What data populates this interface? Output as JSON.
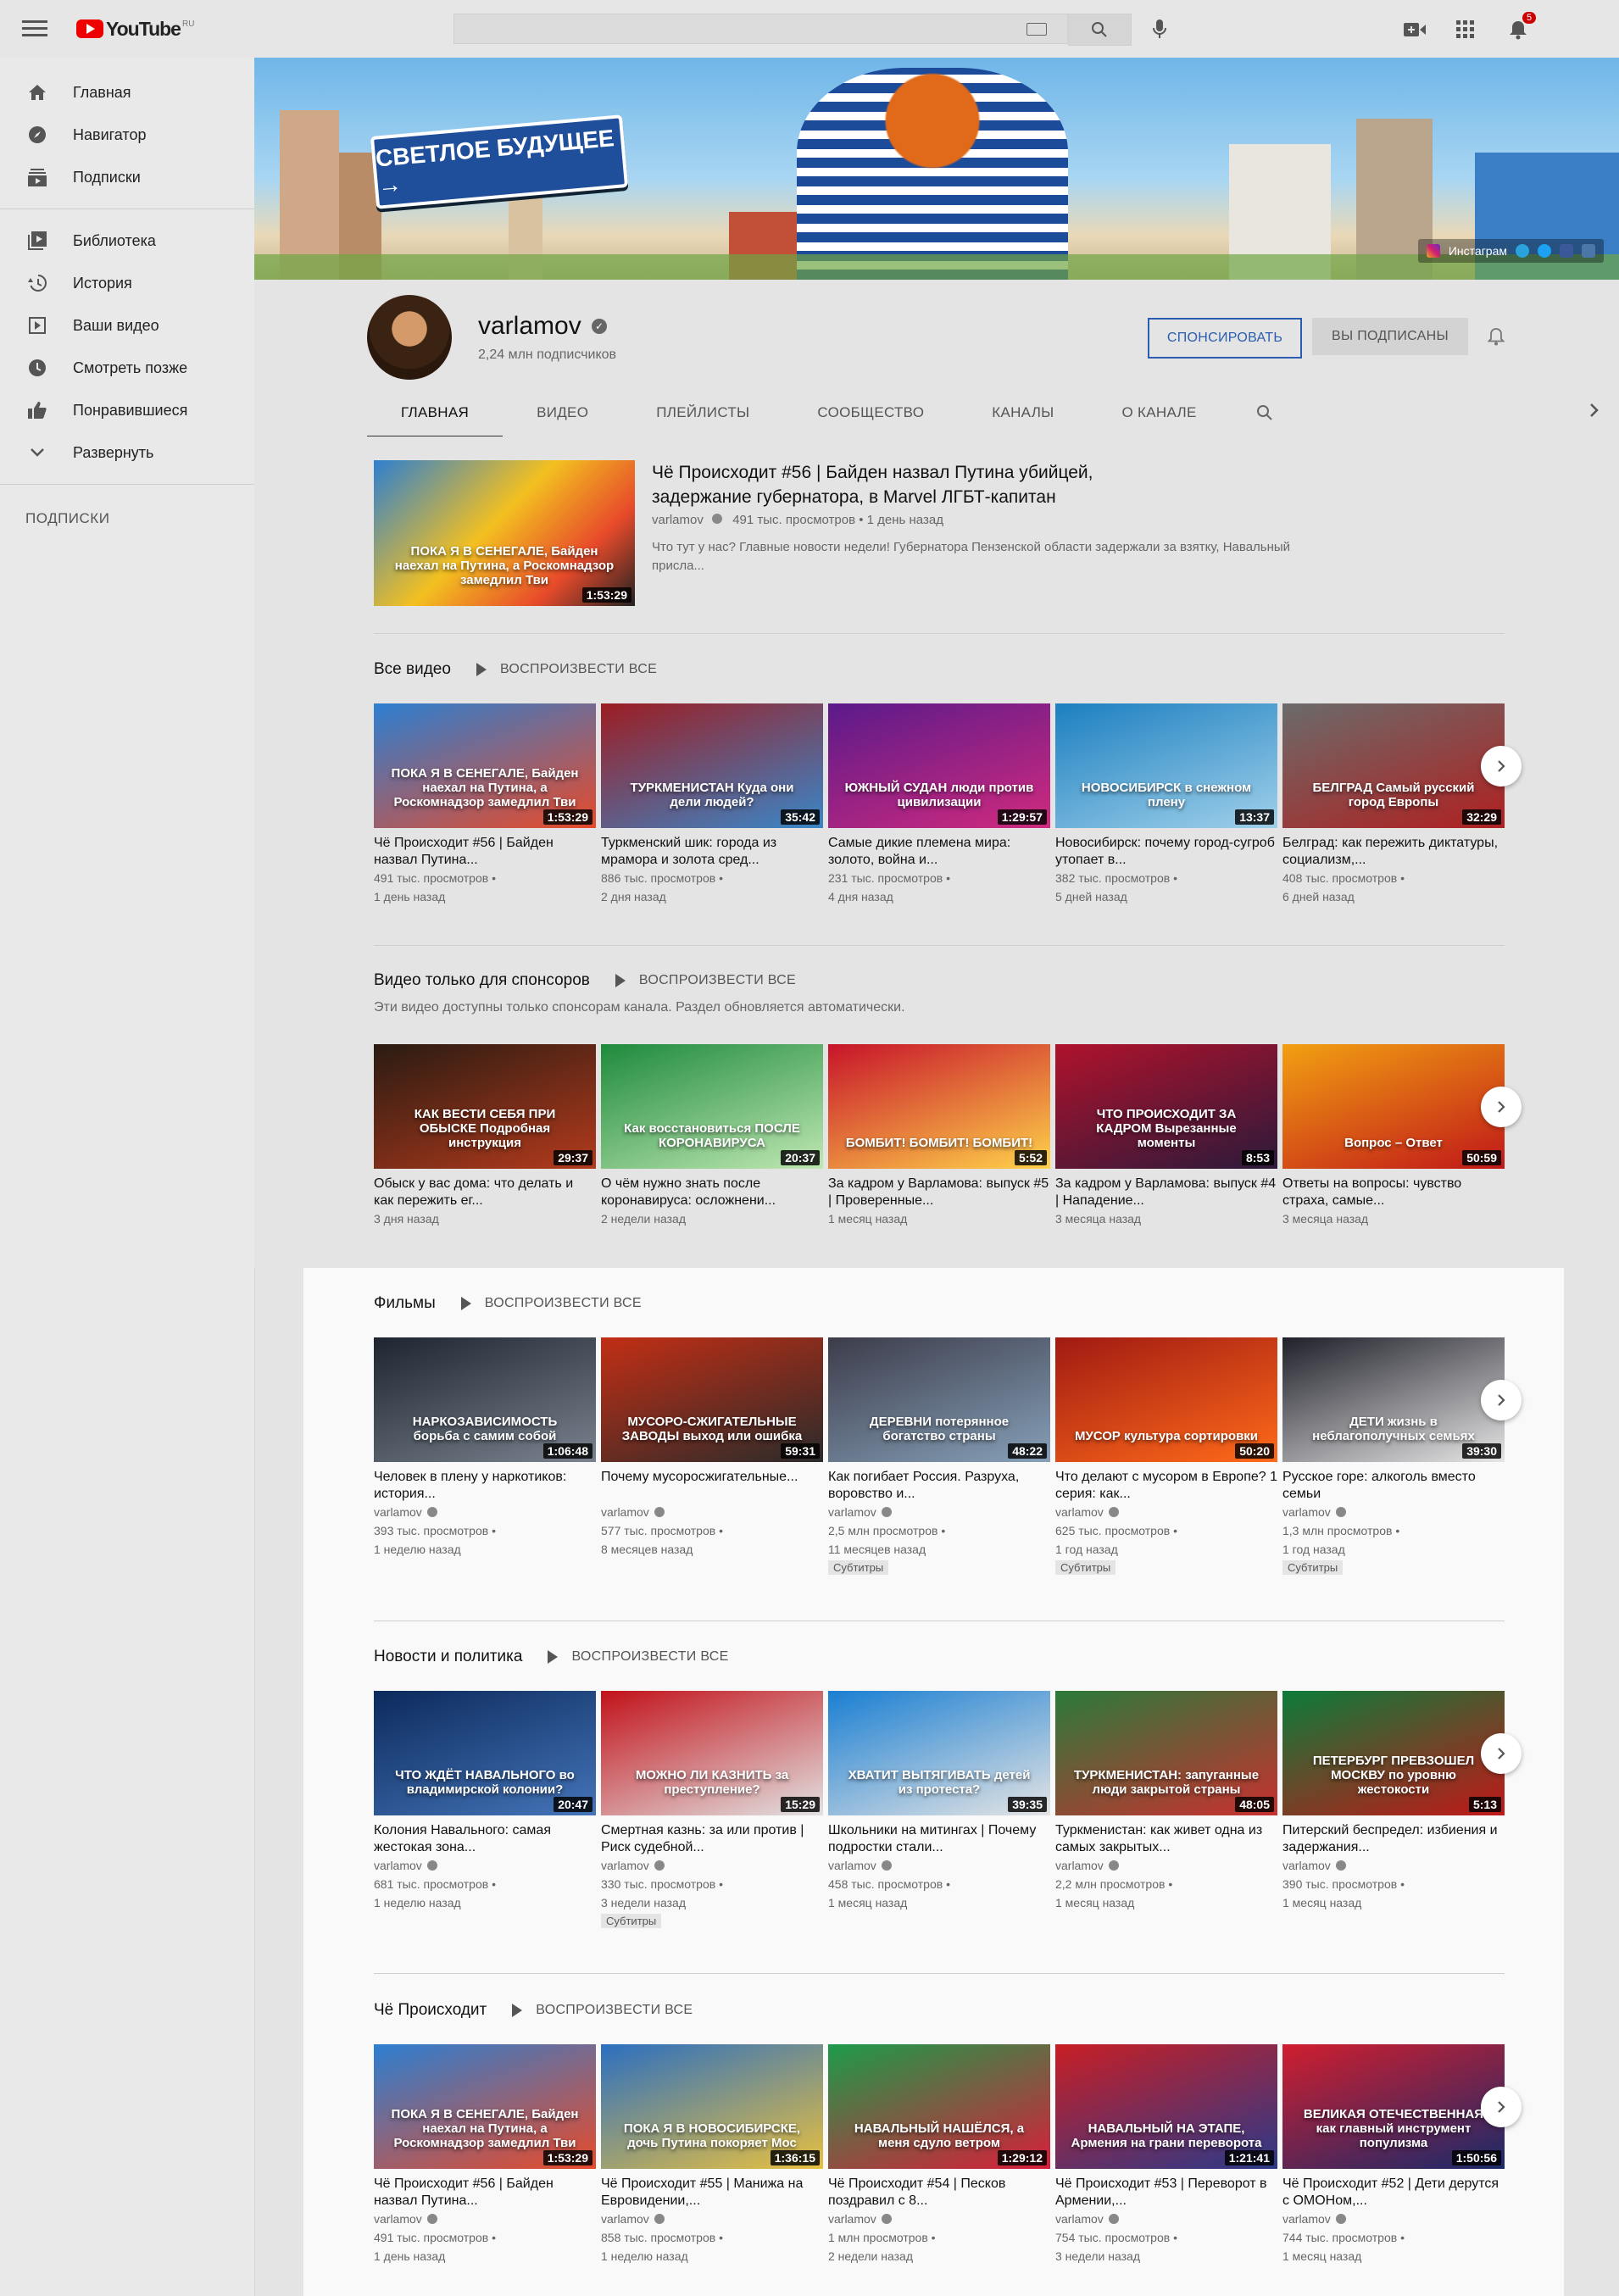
{
  "topbar": {
    "logo_text": "YouTube",
    "logo_region": "RU",
    "search_placeholder": "",
    "notifications_count": "5"
  },
  "sidebar": {
    "items": [
      {
        "label": "Главная",
        "icon": "home-icon"
      },
      {
        "label": "Навигатор",
        "icon": "compass-icon"
      },
      {
        "label": "Подписки",
        "icon": "subscriptions-icon"
      },
      {
        "label": "Библиотека",
        "icon": "library-icon"
      },
      {
        "label": "История",
        "icon": "history-icon"
      },
      {
        "label": "Ваши видео",
        "icon": "your-videos-icon"
      },
      {
        "label": "Смотреть позже",
        "icon": "clock-icon"
      },
      {
        "label": "Понравившиеся",
        "icon": "thumbs-up-icon"
      },
      {
        "label": "Развернуть",
        "icon": "chevron-down-icon"
      }
    ],
    "subscriptions_heading": "ПОДПИСКИ"
  },
  "banner": {
    "sign_text": "СВЕТЛОЕ БУДУЩЕЕ →",
    "social_label": "Инстаграм"
  },
  "channel": {
    "name": "varlamov",
    "subscribers": "2,24 млн подписчиков",
    "sponsor_label": "СПОНСИРОВАТЬ",
    "subscribed_label": "ВЫ ПОДПИСАНЫ",
    "tabs": [
      "ГЛАВНАЯ",
      "ВИДЕО",
      "ПЛЕЙЛИСТЫ",
      "СООБЩЕСТВО",
      "КАНАЛЫ",
      "О КАНАЛЕ"
    ]
  },
  "featured": {
    "title": "Чё Происходит #56 | Байден назвал Путина убийцей, задержание губернатора, в Marvel ЛГБТ-капитан",
    "channel": "varlamov",
    "views": "491 тыс. просмотров",
    "age": "1 день назад",
    "description": "Что тут у нас? Главные новости недели! Губернатора Пензенской области задержали за взятку, Навальный присла...",
    "duration": "1:53:29",
    "thumb_caption": "ПОКА Я В СЕНЕГАЛЕ, Байден наехал на Путина, а Роскомнадзор замедлил Тви"
  },
  "shelves": [
    {
      "title": "Все видео",
      "play_all": "ВОСПРОИЗВЕСТИ ВСЕ",
      "subtitle": "",
      "videos": [
        {
          "title": "Чё Происходит #56 | Байден назвал Путина...",
          "channel": "",
          "views": "491 тыс. просмотров •",
          "age": "1 день назад",
          "duration": "1:53:29",
          "caption": "ПОКА Я В СЕНЕГАЛЕ, Байден наехал на Путина, а Роскомнадзор замедлил Тви",
          "badge": ""
        },
        {
          "title": "Туркменский шик: города из мрамора и золота сред...",
          "channel": "",
          "views": "886 тыс. просмотров •",
          "age": "2 дня назад",
          "duration": "35:42",
          "caption": "ТУРКМЕНИСТАН Куда они дели людей?",
          "badge": ""
        },
        {
          "title": "Самые дикие племена мира: золото, война и...",
          "channel": "",
          "views": "231 тыс. просмотров •",
          "age": "4 дня назад",
          "duration": "1:29:57",
          "caption": "ЮЖНЫЙ СУДАН люди против цивилизации",
          "badge": ""
        },
        {
          "title": "Новосибирск: почему город-сугроб утопает в...",
          "channel": "",
          "views": "382 тыс. просмотров •",
          "age": "5 дней назад",
          "duration": "13:37",
          "caption": "НОВОСИБИРСК в снежном плену",
          "badge": ""
        },
        {
          "title": "Белград: как пережить диктатуры, социализм,...",
          "channel": "",
          "views": "408 тыс. просмотров •",
          "age": "6 дней назад",
          "duration": "32:29",
          "caption": "БЕЛГРАД Самый русский город Европы",
          "badge": ""
        }
      ]
    },
    {
      "title": "Видео только для спонсоров",
      "play_all": "ВОСПРОИЗВЕСТИ ВСЕ",
      "subtitle": "Эти видео доступны только спонсорам канала. Раздел обновляется автоматически.",
      "videos": [
        {
          "title": "Обыск у вас дома: что делать и как пережить ег...",
          "channel": "",
          "views": "",
          "age": "3 дня назад",
          "duration": "29:37",
          "caption": "КАК ВЕСТИ СЕБЯ ПРИ ОБЫСКЕ Подробная инструкция",
          "badge": ""
        },
        {
          "title": "О чём нужно знать после коронавируса: осложнени...",
          "channel": "",
          "views": "",
          "age": "2 недели назад",
          "duration": "20:37",
          "caption": "Как восстановиться ПОСЛЕ КОРОНАВИРУСА",
          "badge": ""
        },
        {
          "title": "За кадром у Варламова: выпуск #5 | Проверенные...",
          "channel": "",
          "views": "",
          "age": "1 месяц назад",
          "duration": "5:52",
          "caption": "БОМБИТ! БОМБИТ! БОМБИТ!",
          "badge": ""
        },
        {
          "title": "За кадром у Варламова: выпуск #4 | Нападение...",
          "channel": "",
          "views": "",
          "age": "3 месяца назад",
          "duration": "8:53",
          "caption": "ЧТО ПРОИСХОДИТ ЗА КАДРОМ Вырезанные моменты",
          "badge": ""
        },
        {
          "title": "Ответы на вопросы: чувство страха, самые...",
          "channel": "",
          "views": "",
          "age": "3 месяца назад",
          "duration": "50:59",
          "caption": "Вопрос – Ответ",
          "badge": ""
        }
      ]
    },
    {
      "title": "Фильмы",
      "play_all": "ВОСПРОИЗВЕСТИ ВСЕ",
      "subtitle": "",
      "videos": [
        {
          "title": "Человек в плену у наркотиков: история...",
          "channel": "varlamov",
          "views": "393 тыс. просмотров •",
          "age": "1 неделю назад",
          "duration": "1:06:48",
          "caption": "НАРКОЗАВИСИМОСТЬ борьба с самим собой",
          "badge": ""
        },
        {
          "title": "Почему мусоросжигательные...",
          "channel": "varlamov",
          "views": "577 тыс. просмотров •",
          "age": "8 месяцев назад",
          "duration": "59:31",
          "caption": "МУСОРО-СЖИГАТЕЛЬНЫЕ ЗАВОДЫ выход или ошибка",
          "badge": ""
        },
        {
          "title": "Как погибает Россия. Разруха, воровство и...",
          "channel": "varlamov",
          "views": "2,5 млн просмотров •",
          "age": "11 месяцев назад",
          "duration": "48:22",
          "caption": "ДЕРЕВНИ потерянное богатство страны",
          "badge": "Субтитры"
        },
        {
          "title": "Что делают с мусором в Европе? 1 серия: как...",
          "channel": "varlamov",
          "views": "625 тыс. просмотров •",
          "age": "1 год назад",
          "duration": "50:20",
          "caption": "МУСОР культура сортировки",
          "badge": "Субтитры"
        },
        {
          "title": "Русское горе: алкоголь вместо семьи",
          "channel": "varlamov",
          "views": "1,3 млн просмотров •",
          "age": "1 год назад",
          "duration": "39:30",
          "caption": "ДЕТИ жизнь в неблагополучных семьях",
          "badge": "Субтитры"
        }
      ]
    },
    {
      "title": "Новости и политика",
      "play_all": "ВОСПРОИЗВЕСТИ ВСЕ",
      "subtitle": "",
      "videos": [
        {
          "title": "Колония Навального: самая жестокая зона...",
          "channel": "varlamov",
          "views": "681 тыс. просмотров •",
          "age": "1 неделю назад",
          "duration": "20:47",
          "caption": "ЧТО ЖДЁТ НАВАЛЬНОГО во владимирской колонии?",
          "badge": ""
        },
        {
          "title": "Смертная казнь: за или против | Риск судебной...",
          "channel": "varlamov",
          "views": "330 тыс. просмотров •",
          "age": "3 недели назад",
          "duration": "15:29",
          "caption": "МОЖНО ЛИ КАЗНИТЬ за преступление?",
          "badge": "Субтитры"
        },
        {
          "title": "Школьники на митингах | Почему подростки стали...",
          "channel": "varlamov",
          "views": "458 тыс. просмотров •",
          "age": "1 месяц назад",
          "duration": "39:35",
          "caption": "ХВАТИТ ВЫТЯГИВАТЬ детей из протеста?",
          "badge": ""
        },
        {
          "title": "Туркменистан: как живет одна из самых закрытых...",
          "channel": "varlamov",
          "views": "2,2 млн просмотров •",
          "age": "1 месяц назад",
          "duration": "48:05",
          "caption": "ТУРКМЕНИСТАН: запуганные люди закрытой страны",
          "badge": ""
        },
        {
          "title": "Питерский беспредел: избиения и задержания...",
          "channel": "varlamov",
          "views": "390 тыс. просмотров •",
          "age": "1 месяц назад",
          "duration": "5:13",
          "caption": "ПЕТЕРБУРГ ПРЕВЗОШЕЛ МОСКВУ по уровню жестокости",
          "badge": ""
        }
      ]
    },
    {
      "title": "Чё Происходит",
      "play_all": "ВОСПРОИЗВЕСТИ ВСЕ",
      "subtitle": "",
      "videos": [
        {
          "title": "Чё Происходит #56 | Байден назвал Путина...",
          "channel": "varlamov",
          "views": "491 тыс. просмотров •",
          "age": "1 день назад",
          "duration": "1:53:29",
          "caption": "ПОКА Я В СЕНЕГАЛЕ, Байден наехал на Путина, а Роскомнадзор замедлил Тви",
          "badge": ""
        },
        {
          "title": "Чё Происходит #55 | Манижа на Евровидении,...",
          "channel": "varlamov",
          "views": "858 тыс. просмотров •",
          "age": "1 неделю назад",
          "duration": "1:36:15",
          "caption": "ПОКА Я В НОВОСИБИРСКЕ, дочь Путина покоряет Мос",
          "badge": ""
        },
        {
          "title": "Чё Происходит #54 | Песков поздравил с 8...",
          "channel": "varlamov",
          "views": "1 млн просмотров •",
          "age": "2 недели назад",
          "duration": "1:29:12",
          "caption": "НАВАЛЬНЫЙ НАШЁЛСЯ, а меня сдуло ветром",
          "badge": ""
        },
        {
          "title": "Чё Происходит #53 | Переворот в Армении,...",
          "channel": "varlamov",
          "views": "754 тыс. просмотров •",
          "age": "3 недели назад",
          "duration": "1:21:41",
          "caption": "НАВАЛЬНЫЙ НА ЭТАПЕ, Армения на грани переворота",
          "badge": ""
        },
        {
          "title": "Чё Происходит #52 | Дети дерутся с ОМОНом,...",
          "channel": "varlamov",
          "views": "744 тыс. просмотров •",
          "age": "1 месяц назад",
          "duration": "1:50:56",
          "caption": "ВЕЛИКАЯ ОТЕЧЕСТВЕННАЯ как главный инструмент популизма",
          "badge": ""
        }
      ]
    }
  ],
  "thumb_colors": [
    [
      "#2d7fd1",
      "#e74a2a"
    ],
    [
      "#9c1d22",
      "#3a86c8"
    ],
    [
      "#5a1a8a",
      "#d12a7e"
    ],
    [
      "#1c7fc0",
      "#9fd0ea"
    ],
    [
      "#6b6b6b",
      "#b02020"
    ],
    [
      "#2a1b12",
      "#b33a1c"
    ],
    [
      "#1e8a3c",
      "#bfe8b2"
    ],
    [
      "#c7142a",
      "#ffd24a"
    ],
    [
      "#b0122c",
      "#2c1a3a"
    ],
    [
      "#f2a012",
      "#c01818"
    ],
    [
      "#1e2530",
      "#79828e"
    ],
    [
      "#c22e14",
      "#2b2b2b"
    ],
    [
      "#3c3c4a",
      "#86a0b8"
    ],
    [
      "#a01a12",
      "#ff6a1a"
    ],
    [
      "#20202a",
      "#e6e6e6"
    ],
    [
      "#0c2a5c",
      "#4474b8"
    ],
    [
      "#c2121a",
      "#e2e2e2"
    ],
    [
      "#1a7fd2",
      "#e4e4e4"
    ],
    [
      "#2b7a3a",
      "#c83030"
    ],
    [
      "#0c7b3a",
      "#c01818"
    ],
    [
      "#2d7fd1",
      "#e74a2a"
    ],
    [
      "#2b6fc0",
      "#e8c040"
    ],
    [
      "#1c9b4a",
      "#d81e3a"
    ],
    [
      "#c81e24",
      "#2b3a8a"
    ],
    [
      "#d01e2e",
      "#1a2a6a"
    ]
  ]
}
